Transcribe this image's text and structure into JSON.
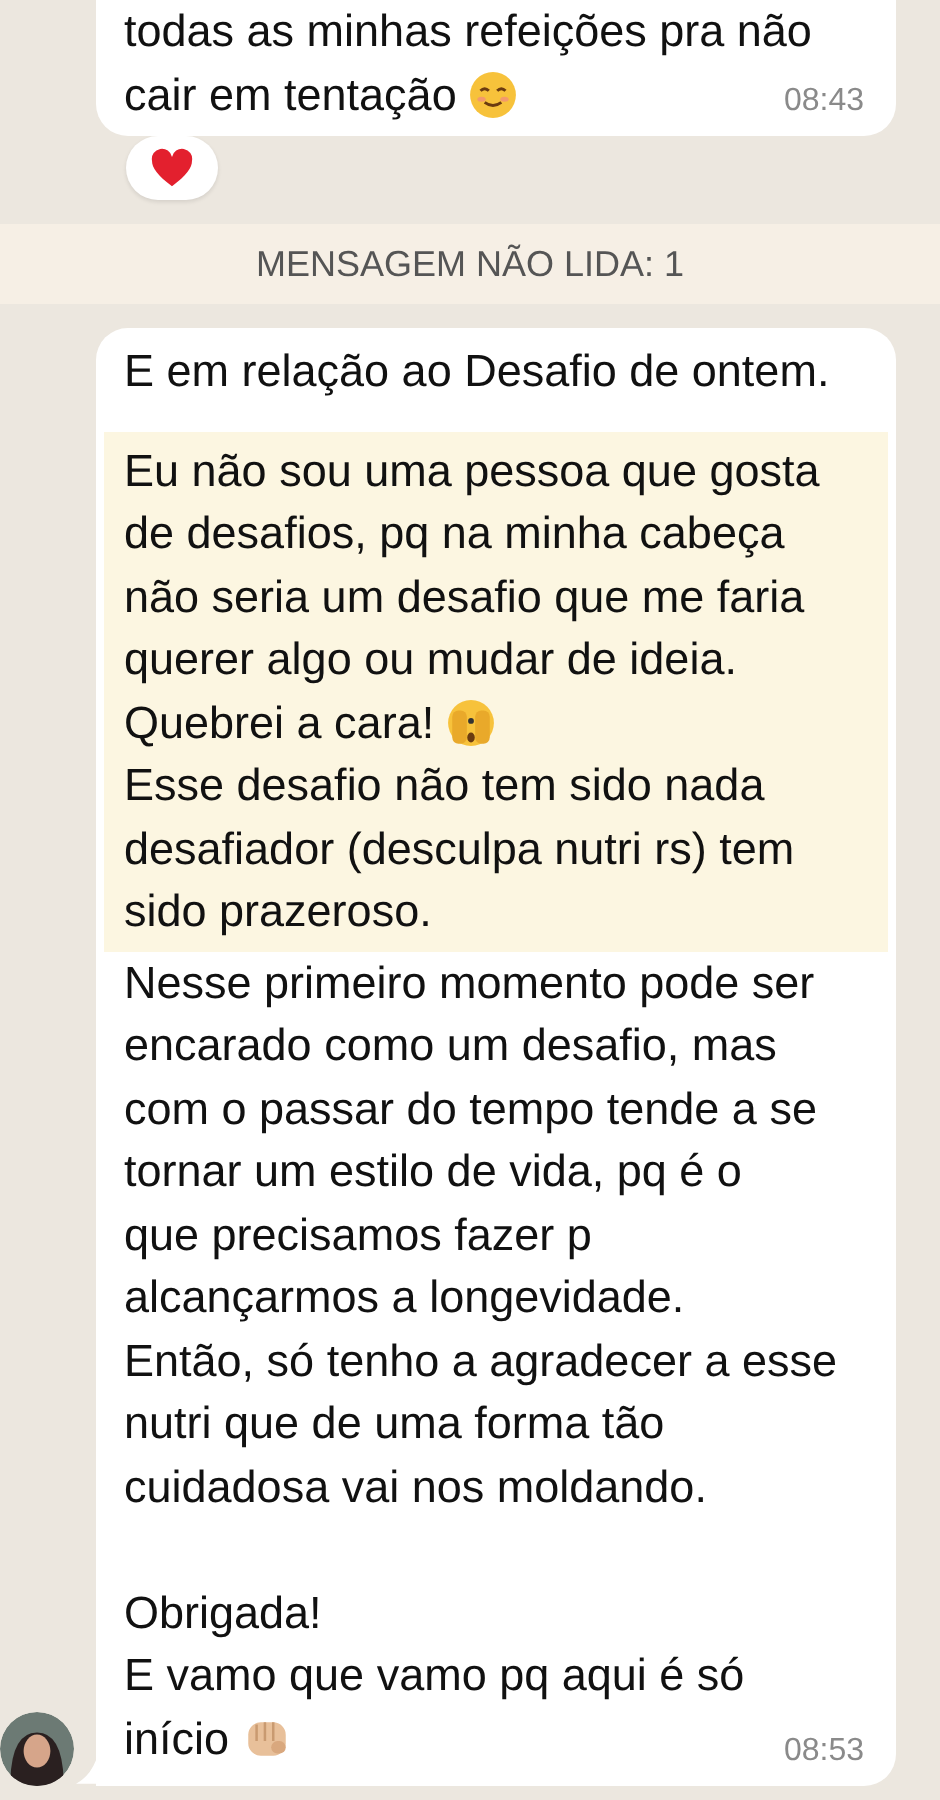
{
  "previous_message": {
    "lines": [
      {
        "text": "todas as minhas refeições pra não",
        "kind": "plain"
      },
      {
        "text": "cair em tentação",
        "kind": "smile"
      }
    ],
    "time": "08:43"
  },
  "unread_banner": "MENSAGEM NÃO LIDA: 1",
  "message": {
    "blocks": [
      {
        "highlighted": false,
        "gap_before": false,
        "lines": [
          {
            "text": "E em relação ao Desafio de ontem.",
            "kind": "plain"
          }
        ]
      },
      {
        "highlighted": true,
        "gap_before": false,
        "lines": [
          {
            "text": "Eu não sou uma pessoa que gosta",
            "kind": "plain"
          },
          {
            "text": "de desafios, pq na minha cabeça",
            "kind": "plain"
          },
          {
            "text": "não seria um desafio que me faria",
            "kind": "plain"
          },
          {
            "text": "querer algo ou mudar de ideia.",
            "kind": "plain"
          },
          {
            "text": "Quebrei a cara!",
            "kind": "peek"
          },
          {
            "text": "Esse desafio não tem sido nada",
            "kind": "plain"
          },
          {
            "text": "desafiador (desculpa nutri rs) tem",
            "kind": "plain"
          },
          {
            "text": "sido prazeroso.",
            "kind": "plain"
          }
        ]
      },
      {
        "highlighted": false,
        "gap_before": false,
        "lines": [
          {
            "text": "Nesse primeiro momento pode ser",
            "kind": "plain"
          },
          {
            "text": "encarado como um desafio, mas",
            "kind": "plain"
          },
          {
            "text": "com o passar do tempo tende a se",
            "kind": "plain"
          },
          {
            "text": "tornar um estilo de vida, pq é o",
            "kind": "plain"
          },
          {
            "text": "que precisamos fazer p",
            "kind": "plain"
          },
          {
            "text": "alcançarmos a longevidade.",
            "kind": "plain"
          },
          {
            "text": "Então, só tenho a agradecer a esse",
            "kind": "plain"
          },
          {
            "text": "nutri que de uma forma tão",
            "kind": "plain"
          },
          {
            "text": "cuidadosa vai nos moldando.",
            "kind": "plain"
          }
        ]
      },
      {
        "highlighted": false,
        "gap_before": true,
        "lines": [
          {
            "text": "Obrigada!",
            "kind": "plain"
          },
          {
            "text": "E vamo que vamo pq aqui é só",
            "kind": "plain"
          },
          {
            "text": "início",
            "kind": "fist"
          }
        ]
      }
    ],
    "time": "08:53"
  }
}
